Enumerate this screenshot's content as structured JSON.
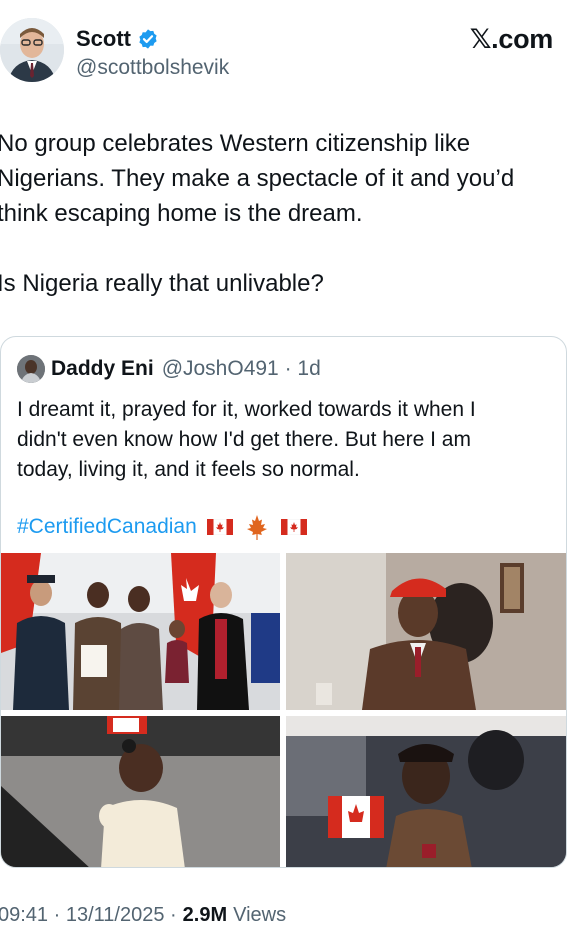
{
  "author": {
    "display_name": "Scott",
    "handle": "@scottbolshevik",
    "verified_icon": "verified-badge-icon"
  },
  "brand": {
    "glyph": "𝕏",
    "suffix": ".com"
  },
  "tweet": {
    "lines": [
      "No group celebrates Western citizenship like",
      "Nigerians. They make a spectacle of it and you’d",
      "think escaping home is the dream.",
      "Is Nigeria really that unlivable?"
    ]
  },
  "quote": {
    "display_name": "Daddy Eni",
    "handle_time": "@JoshO491 · 1d",
    "lines": [
      "I dreamt it, prayed for it, worked towards it when I",
      "didn't even know how I'd get there. But here I am",
      "today, living it, and it feels so normal."
    ],
    "hashtag": "#CertifiedCanadian",
    "emoji": [
      "canada-flag-icon",
      "maple-leaf-icon",
      "canada-flag-icon"
    ],
    "media": [
      "citizenship-ceremony-group-photo",
      "man-in-red-cap-and-suit",
      "toddler-holding-flag",
      "smiling-man-with-flag-in-audience"
    ]
  },
  "footer": {
    "timestamp": "09:41 · 13/11/2025 · ",
    "views_count": "2.9M",
    "views_label": "Views"
  },
  "colors": {
    "text": "#0f1419",
    "secondary": "#536471",
    "link": "#1d9bf0",
    "border": "#cfd9de",
    "canada_red": "#d52b1e"
  }
}
